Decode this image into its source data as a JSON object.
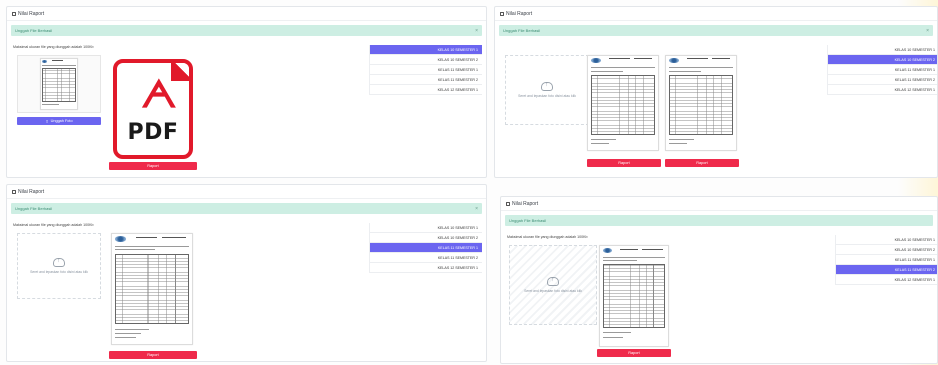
{
  "panel_title": "Nilai Raport",
  "alert_text": "Unggah File Berhasil",
  "alert_close": "×",
  "max_note": "Maksimal ukuran file yang diunggah adalah 100Kb",
  "dropzone_hint": "Seret and lepaskan foto disini atau klik",
  "upload_button": "Unggah Foto",
  "raport_button": "Raport",
  "pdf_label": "PDF",
  "pdf_glyph": "ᗅ",
  "semesters": [
    "KELAS 10 SEMESTER 1",
    "KELAS 10 SEMESTER 2",
    "KELAS 11 SEMESTER 1",
    "KELAS 11 SEMESTER 2",
    "KELAS 12 SEMESTER 1"
  ],
  "panels": {
    "tl": {
      "active_index": 0
    },
    "tr": {
      "active_index": 1
    },
    "bl": {
      "active_index": 2
    },
    "br": {
      "active_index": 3
    }
  },
  "colors": {
    "accent": "#6b65f0",
    "danger": "#ef2a4b",
    "success_bg": "#cdeee3",
    "pdf_red": "#e1192a"
  }
}
